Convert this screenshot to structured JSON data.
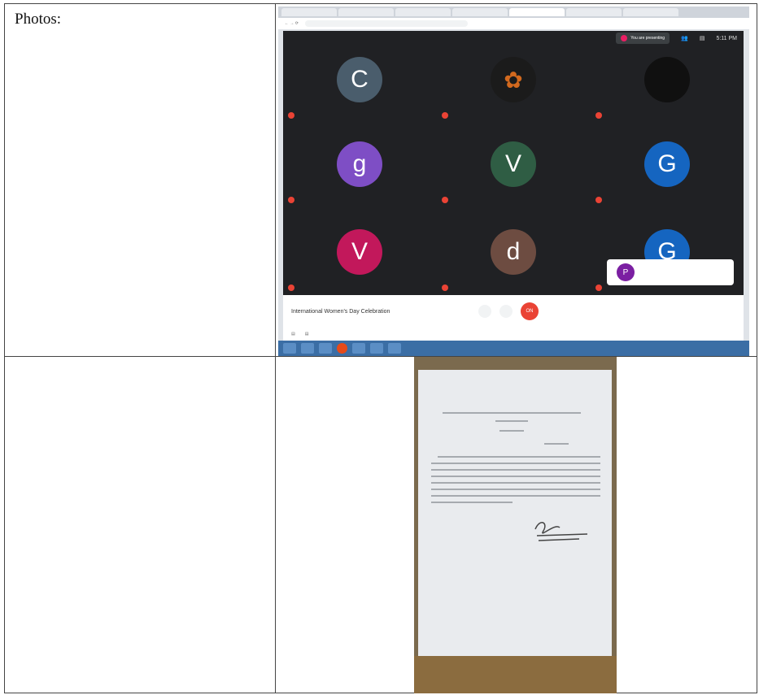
{
  "cell_label": "Photos:",
  "screenshot": {
    "meet": {
      "presenting": "You are presenting",
      "time": "5:11 PM",
      "participants": [
        {
          "initial": "C",
          "color": "#4a5d6c"
        },
        {
          "initial": "",
          "color": "#1b1b1b"
        },
        {
          "initial": "",
          "color": "#101010"
        },
        {
          "initial": "g",
          "color": "#7e4ec5"
        },
        {
          "initial": "V",
          "color": "#2f5d44"
        },
        {
          "initial": "G",
          "color": "#1565c0"
        },
        {
          "initial": "V",
          "color": "#c2185b"
        },
        {
          "initial": "d",
          "color": "#6d4c41"
        },
        {
          "initial": "G",
          "color": "#1565c0"
        }
      ],
      "popup_initial": "P",
      "meeting_title": "International Women's Day Celebration",
      "end_label": "ON"
    }
  },
  "colors": {
    "meet_bg": "#202124",
    "end_call": "#ea4335",
    "taskbar": "#3b6ea5"
  }
}
